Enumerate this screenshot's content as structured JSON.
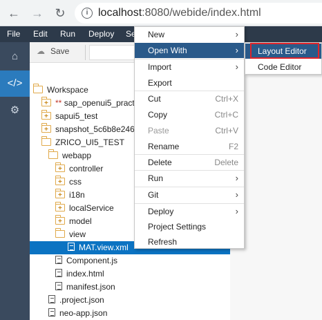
{
  "browser": {
    "url_host": "localhost",
    "url_path": ":8080/webide/index.html"
  },
  "menubar": [
    "File",
    "Edit",
    "Run",
    "Deploy",
    "Se"
  ],
  "toolbar": {
    "save_label": "Save"
  },
  "tree": [
    {
      "label": "Workspace",
      "icon": "folder-open-icon",
      "indent": 0
    },
    {
      "label": "sap_openui5_pract",
      "prefix": "** ",
      "icon": "folder-plus-icon",
      "indent": 1
    },
    {
      "label": "sapui5_test",
      "icon": "folder-plus-icon",
      "indent": 1
    },
    {
      "label": "snapshot_5c6b8e246",
      "icon": "folder-plus-icon",
      "indent": 1
    },
    {
      "label": "ZRICO_UI5_TEST",
      "icon": "folder-open-icon",
      "indent": 1
    },
    {
      "label": "webapp",
      "icon": "folder-open-icon",
      "indent": 2
    },
    {
      "label": "controller",
      "icon": "folder-plus-icon",
      "indent": 3
    },
    {
      "label": "css",
      "icon": "folder-plus-icon",
      "indent": 3
    },
    {
      "label": "i18n",
      "icon": "folder-plus-icon",
      "indent": 3
    },
    {
      "label": "localService",
      "icon": "folder-plus-icon",
      "indent": 3
    },
    {
      "label": "model",
      "icon": "folder-plus-icon",
      "indent": 3
    },
    {
      "label": "view",
      "icon": "folder-open-icon",
      "indent": 3
    },
    {
      "label": "MAT.view.xml",
      "icon": "file-icon",
      "indent": 4,
      "selected": true
    },
    {
      "label": "Component.js",
      "icon": "file-icon",
      "indent": 3
    },
    {
      "label": "index.html",
      "icon": "file-icon",
      "indent": 3
    },
    {
      "label": "manifest.json",
      "icon": "file-icon",
      "indent": 3
    },
    {
      "label": ".project.json",
      "icon": "file-icon",
      "indent": 2
    },
    {
      "label": "neo-app.json",
      "icon": "file-icon",
      "indent": 2
    }
  ],
  "context_menu": {
    "new": "New",
    "open_with": "Open With",
    "import": "Import",
    "export": "Export",
    "cut": "Cut",
    "cut_sc": "Ctrl+X",
    "copy": "Copy",
    "copy_sc": "Ctrl+C",
    "paste": "Paste",
    "paste_sc": "Ctrl+V",
    "rename": "Rename",
    "rename_sc": "F2",
    "delete": "Delete",
    "delete_sc": "Delete",
    "run": "Run",
    "git": "Git",
    "deploy": "Deploy",
    "project_settings": "Project Settings",
    "refresh": "Refresh"
  },
  "submenu": {
    "layout_editor": "Layout Editor",
    "code_editor": "Code Editor"
  }
}
